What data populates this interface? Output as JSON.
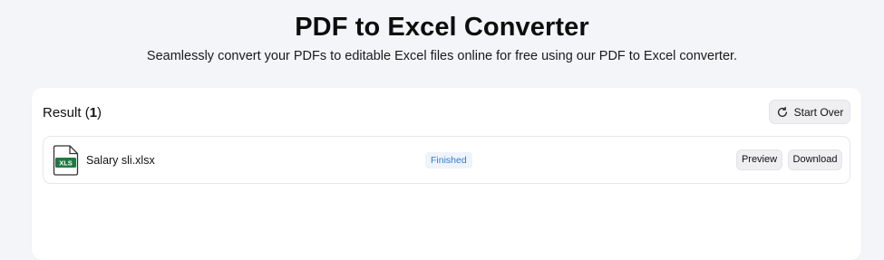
{
  "header": {
    "title": "PDF to Excel Converter",
    "subtitle": "Seamlessly convert your PDFs to editable Excel files online for free using our PDF to Excel converter."
  },
  "result": {
    "label": "Result",
    "count": "1",
    "start_over_label": "Start Over",
    "start_over_icon": "refresh-icon"
  },
  "files": [
    {
      "icon": "xls-file-icon",
      "icon_text": "XLS",
      "name": "Salary sli.xlsx",
      "status": "Finished",
      "preview_label": "Preview",
      "download_label": "Download"
    }
  ],
  "colors": {
    "page_bg": "#f4f5f9",
    "xls_green": "#1e7a3f",
    "status_blue": "#2f7dd1",
    "status_bg": "#eef4fb"
  }
}
